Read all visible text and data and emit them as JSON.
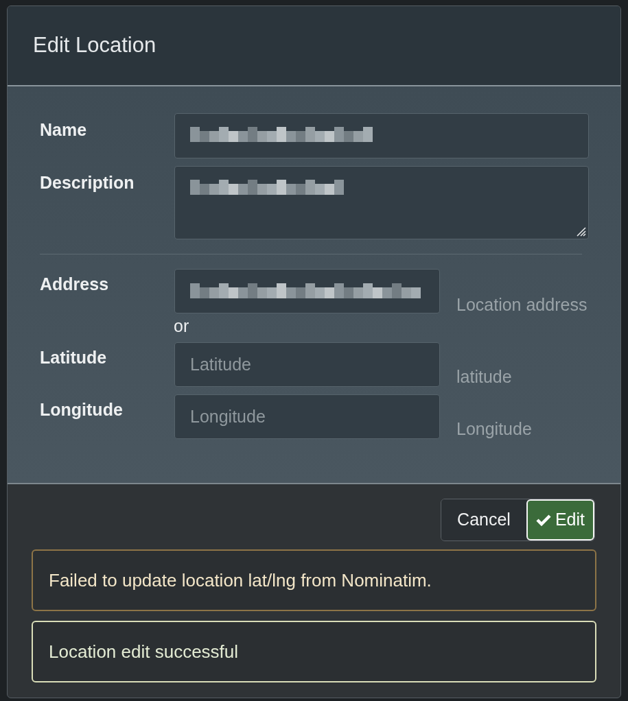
{
  "dialog": {
    "title": "Edit Location"
  },
  "fields": [
    {
      "kind": "input",
      "label": "Name",
      "redacted": true
    },
    {
      "kind": "textarea",
      "label": "Description",
      "redacted": true
    }
  ],
  "location_fields": [
    {
      "label": "Address",
      "redacted": true,
      "help": "Location address"
    },
    {
      "label": "Latitude",
      "placeholder": "Latitude",
      "help": "latitude"
    },
    {
      "label": "Longitude",
      "placeholder": "Longitude",
      "help": "Longitude"
    }
  ],
  "separator_text": "or",
  "buttons": [
    {
      "label": "Cancel",
      "kind": "default"
    },
    {
      "label": "Edit",
      "kind": "primary"
    }
  ],
  "alerts": [
    {
      "kind": "warning",
      "text": "Failed to update location lat/lng from Nominatim."
    },
    {
      "kind": "success",
      "text": "Location edit successful"
    }
  ]
}
